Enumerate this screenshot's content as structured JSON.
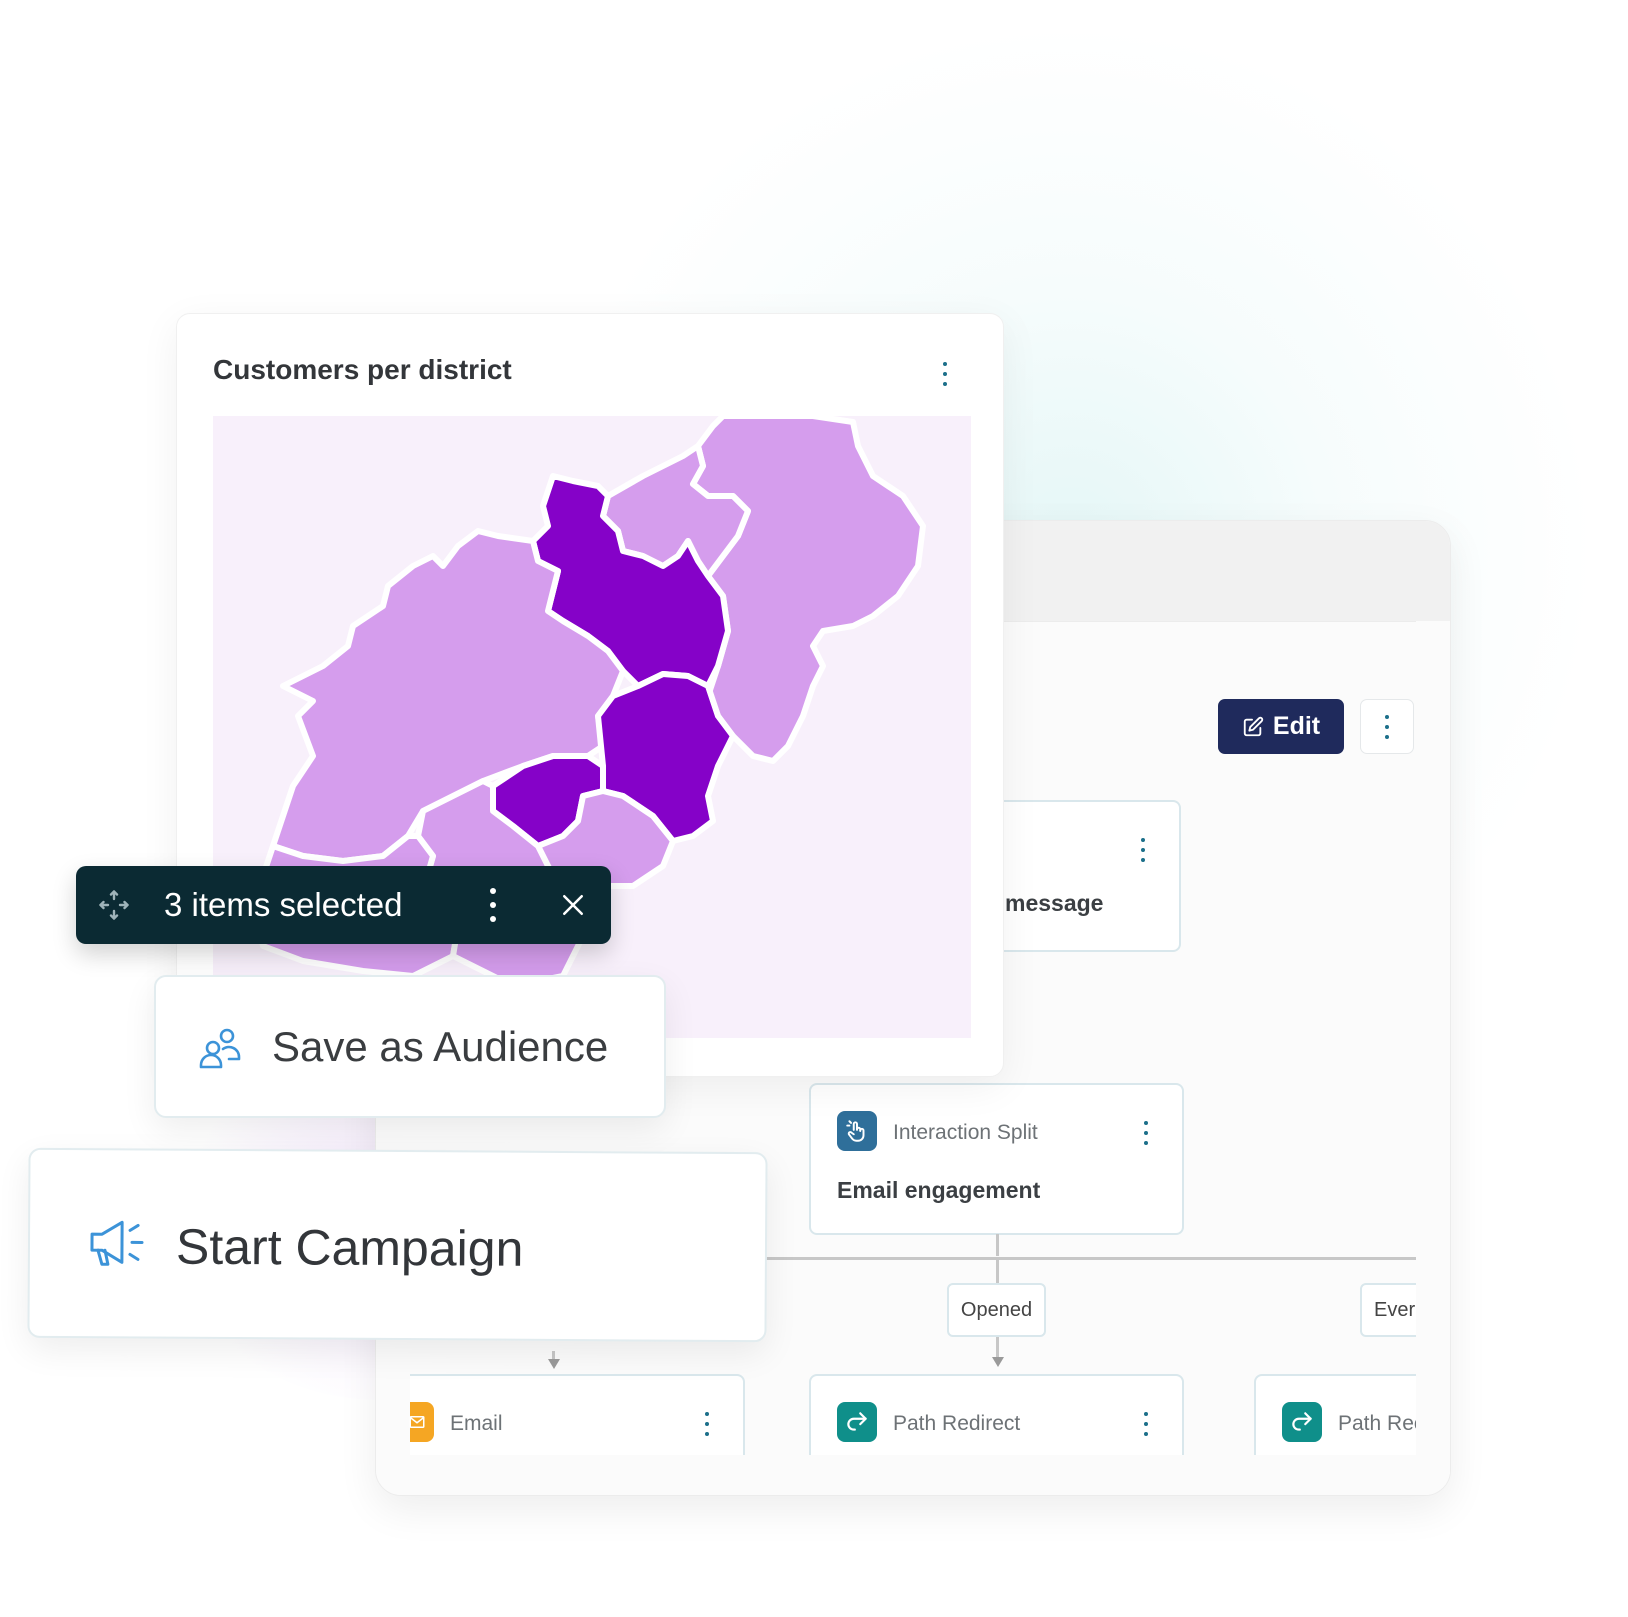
{
  "map_widget": {
    "title": "Customers per district",
    "colors": {
      "unselected": "#d59ded",
      "selected": "#8502c8",
      "background": "#f8f0fb"
    }
  },
  "selection_bar": {
    "text": "3 items selected"
  },
  "actions": {
    "save_audience": "Save as Audience",
    "start_campaign": "Start Campaign"
  },
  "journey": {
    "edit_label": "Edit",
    "nodes": {
      "message_title": "message",
      "split_type": "Interaction Split",
      "split_title": "Email engagement",
      "email_type": "Email",
      "redirect_type": "Path Redirect",
      "redirect2_type": "Path Rec"
    },
    "branch_labels": [
      "Opened",
      "Ever"
    ]
  },
  "colors": {
    "edit_button": "#1f2a5c",
    "selection_bar": "#0b2a33",
    "email_icon": "#f5a623",
    "redirect_icon": "#0f8f8a",
    "split_icon": "#2f6f9a",
    "action_icon": "#3c93d8"
  }
}
